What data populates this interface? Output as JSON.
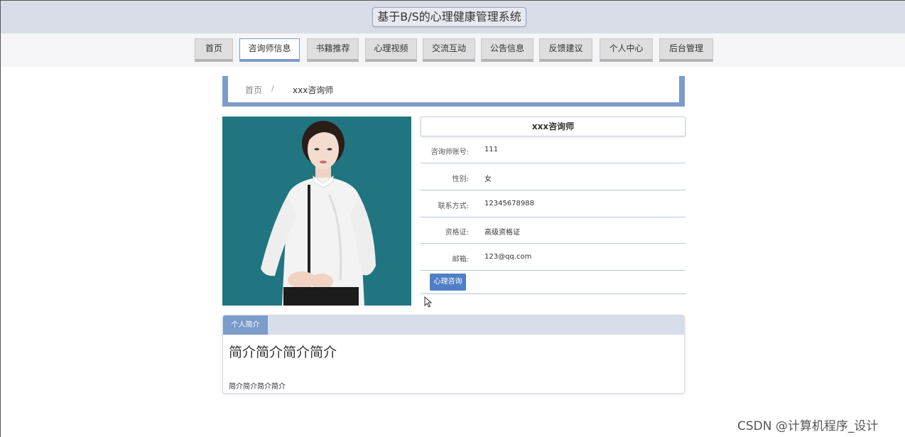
{
  "header": {
    "site_title": "基于B/S的心理健康管理系统"
  },
  "nav": {
    "items": [
      {
        "label": "首页"
      },
      {
        "label": "咨询师信息"
      },
      {
        "label": "书籍推荐"
      },
      {
        "label": "心理视频"
      },
      {
        "label": "交流互动"
      },
      {
        "label": "公告信息"
      },
      {
        "label": "反馈建议"
      },
      {
        "label": "个人中心"
      },
      {
        "label": "后台管理"
      }
    ],
    "active": "咨询师信息"
  },
  "breadcrumb": {
    "home": "首页",
    "separator": "/",
    "current": "xxx咨询师"
  },
  "counselor": {
    "name": "xxx咨询师",
    "fields": [
      {
        "label": "咨询师账号:",
        "value": "111"
      },
      {
        "label": "性别:",
        "value": "女"
      },
      {
        "label": "联系方式:",
        "value": "12345678988"
      },
      {
        "label": "资格证:",
        "value": "高级资格证"
      },
      {
        "label": "邮箱:",
        "value": "123@qq.com"
      }
    ],
    "consult_button": "心理咨询"
  },
  "intro": {
    "tab_label": "个人简介",
    "heading": "简介简介简介简介",
    "body": "简介简介简介简介"
  },
  "watermark": "CSDN @计算机程序_设计",
  "colors": {
    "accent": "#7c9cc9",
    "button": "#4f7fc6",
    "header_bg": "#d8dde8",
    "photo_bg": "#207580"
  }
}
